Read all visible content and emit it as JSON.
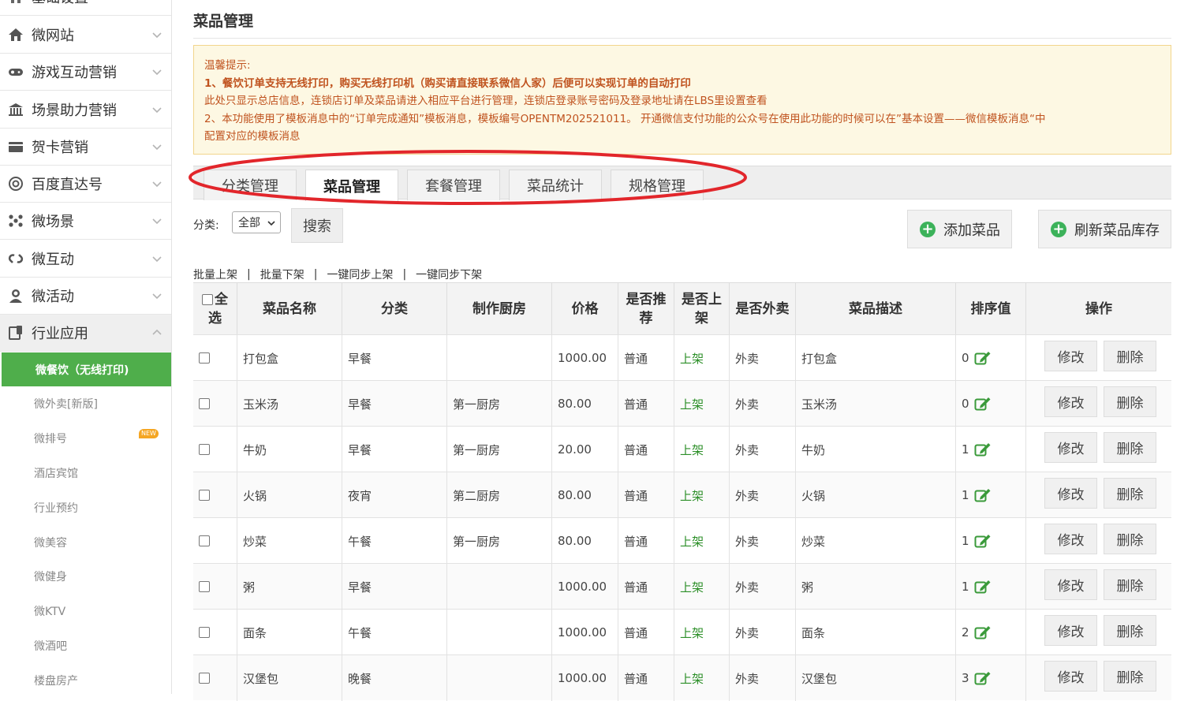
{
  "sidebar": {
    "top_partial_label": "基础设置",
    "items": [
      {
        "label": "微网站",
        "icon": "home-icon"
      },
      {
        "label": "游戏互动营销",
        "icon": "gamepad-icon"
      },
      {
        "label": "场景助力营销",
        "icon": "bank-icon"
      },
      {
        "label": "贺卡营销",
        "icon": "card-icon"
      },
      {
        "label": "百度直达号",
        "icon": "at-icon"
      },
      {
        "label": "微场景",
        "icon": "network-icon"
      },
      {
        "label": "微互动",
        "icon": "link-icon"
      },
      {
        "label": "微活动",
        "icon": "user-icon"
      },
      {
        "label": "行业应用",
        "icon": "window-icon"
      }
    ],
    "sub_items": [
      {
        "label": "微餐饮（无线打印)"
      },
      {
        "label": "微外卖[新版]"
      },
      {
        "label": "微排号",
        "badge": "NEW"
      },
      {
        "label": "酒店宾馆"
      },
      {
        "label": "行业预约"
      },
      {
        "label": "微美容"
      },
      {
        "label": "微健身"
      },
      {
        "label": "微KTV"
      },
      {
        "label": "微酒吧"
      },
      {
        "label": "楼盘房产"
      }
    ]
  },
  "page": {
    "title": "菜品管理"
  },
  "notice": {
    "heading": "温馨提示:",
    "line1": "1、餐饮订单支持无线打印，购买无线打印机（购买请直接联系微信人家）后便可以实现订单的自动打印",
    "line2": "此处只显示总店信息，连锁店订单及菜品请进入相应平台进行管理，连锁店登录账号密码及登录地址请在LBS里设置查看",
    "line3": "2、本功能使用了模板消息中的“订单完成通知”模板消息，模板编号OPENTM202521011。 开通微信支付功能的公众号在使用此功能的时候可以在”基本设置——微信模板消息“中",
    "line4": "配置对应的模板消息"
  },
  "tabs": [
    {
      "label": "分类管理",
      "active": false
    },
    {
      "label": "菜品管理",
      "active": true
    },
    {
      "label": "套餐管理",
      "active": false
    },
    {
      "label": "菜品统计",
      "active": false
    },
    {
      "label": "规格管理",
      "active": false
    }
  ],
  "filter": {
    "label": "分类:",
    "selected": "全部",
    "search_label": "搜索"
  },
  "actions": {
    "add_label": "添加菜品",
    "refresh_label": "刷新菜品库存"
  },
  "batch": {
    "on_shelf": "批量上架",
    "off_shelf": "批量下架",
    "sync_on": "一键同步上架",
    "sync_off": "一键同步下架",
    "separator": "|"
  },
  "table": {
    "headers": {
      "select_all": "全选",
      "name": "菜品名称",
      "category": "分类",
      "kitchen": "制作厨房",
      "price": "价格",
      "recommend": "是否推荐",
      "on_shelf": "是否上架",
      "takeout": "是否外卖",
      "desc": "菜品描述",
      "sort": "排序值",
      "ops": "操作"
    },
    "headers_wrapped": {
      "select_all_1": "全",
      "select_all_2": "选",
      "recommend_1": "是否推",
      "recommend_2": "荐",
      "on_shelf_1": "是否上",
      "on_shelf_2": "架"
    },
    "edit_label": "修改",
    "delete_label": "删除",
    "rows": [
      {
        "name": "打包盒",
        "category": "早餐",
        "kitchen": "",
        "price": "1000.00",
        "recommend": "普通",
        "status": "上架",
        "takeout": "外卖",
        "desc": "打包盒",
        "sort": "0"
      },
      {
        "name": "玉米汤",
        "category": "早餐",
        "kitchen": "第一厨房",
        "price": "80.00",
        "recommend": "普通",
        "status": "上架",
        "takeout": "外卖",
        "desc": "玉米汤",
        "sort": "0"
      },
      {
        "name": "牛奶",
        "category": "早餐",
        "kitchen": "第一厨房",
        "price": "20.00",
        "recommend": "普通",
        "status": "上架",
        "takeout": "外卖",
        "desc": "牛奶",
        "sort": "1"
      },
      {
        "name": "火锅",
        "category": "夜宵",
        "kitchen": "第二厨房",
        "price": "80.00",
        "recommend": "普通",
        "status": "上架",
        "takeout": "外卖",
        "desc": "火锅",
        "sort": "1"
      },
      {
        "name": "炒菜",
        "category": "午餐",
        "kitchen": "第一厨房",
        "price": "80.00",
        "recommend": "普通",
        "status": "上架",
        "takeout": "外卖",
        "desc": "炒菜",
        "sort": "1"
      },
      {
        "name": "粥",
        "category": "早餐",
        "kitchen": "",
        "price": "1000.00",
        "recommend": "普通",
        "status": "上架",
        "takeout": "外卖",
        "desc": "粥",
        "sort": "1"
      },
      {
        "name": "面条",
        "category": "午餐",
        "kitchen": "",
        "price": "1000.00",
        "recommend": "普通",
        "status": "上架",
        "takeout": "外卖",
        "desc": "面条",
        "sort": "2"
      },
      {
        "name": "汉堡包",
        "category": "晚餐",
        "kitchen": "",
        "price": "1000.00",
        "recommend": "普通",
        "status": "上架",
        "takeout": "外卖",
        "desc": "汉堡包",
        "sort": "3"
      }
    ]
  },
  "colors": {
    "accent_green": "#4fae4b",
    "status_green": "#2c8f28",
    "notice_text": "#c0531f",
    "highlight_ring": "#e2262b"
  }
}
